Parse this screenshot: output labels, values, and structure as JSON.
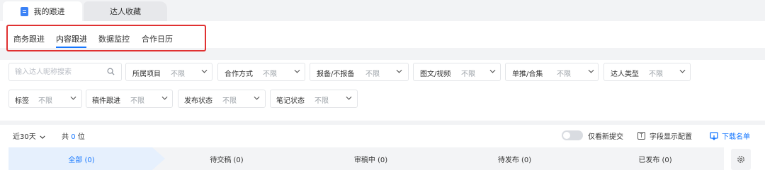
{
  "top_tabs": [
    {
      "label": "我的跟进"
    },
    {
      "label": "达人收藏"
    }
  ],
  "sub_tabs": [
    {
      "label": "商务跟进"
    },
    {
      "label": "内容跟进"
    },
    {
      "label": "数据监控"
    },
    {
      "label": "合作日历"
    }
  ],
  "sub_tabs_active": "内容跟进",
  "search": {
    "placeholder": "输入达人昵称搜索",
    "value": ""
  },
  "filters": [
    {
      "label": "所属项目",
      "value": "不限"
    },
    {
      "label": "合作方式",
      "value": "不限"
    },
    {
      "label": "报备/不报备",
      "value": "不限"
    },
    {
      "label": "图文/视频",
      "value": "不限"
    },
    {
      "label": "单推/合集",
      "value": "不限"
    },
    {
      "label": "达人类型",
      "value": "不限"
    },
    {
      "label": "标签",
      "value": "不限"
    },
    {
      "label": "稿件跟进",
      "value": "不限"
    },
    {
      "label": "发布状态",
      "value": "不限"
    },
    {
      "label": "笔记状态",
      "value": "不限"
    }
  ],
  "list_header": {
    "range": "近30天",
    "total_prefix": "共",
    "total_count": "0",
    "total_suffix": "位",
    "toggle_label": "仅看新提交",
    "field_config_label": "字段显示配置",
    "download_label": "下载名单"
  },
  "status_steps": [
    {
      "label": "全部 (0)"
    },
    {
      "label": "待交稿 (0)"
    },
    {
      "label": "审稿中 (0)"
    },
    {
      "label": "待发布 (0)"
    },
    {
      "label": "已发布 (0)"
    }
  ],
  "colors": {
    "accent": "#1677ff",
    "highlight_border": "#e03131",
    "active_step_bg": "#e6f0fd",
    "step_bg": "#f3f4f6",
    "page_bg": "#f2f3f5"
  },
  "icons": [
    "doc-icon",
    "search-icon",
    "chevron-down-icon",
    "field-config-icon",
    "download-icon",
    "gear-icon"
  ]
}
